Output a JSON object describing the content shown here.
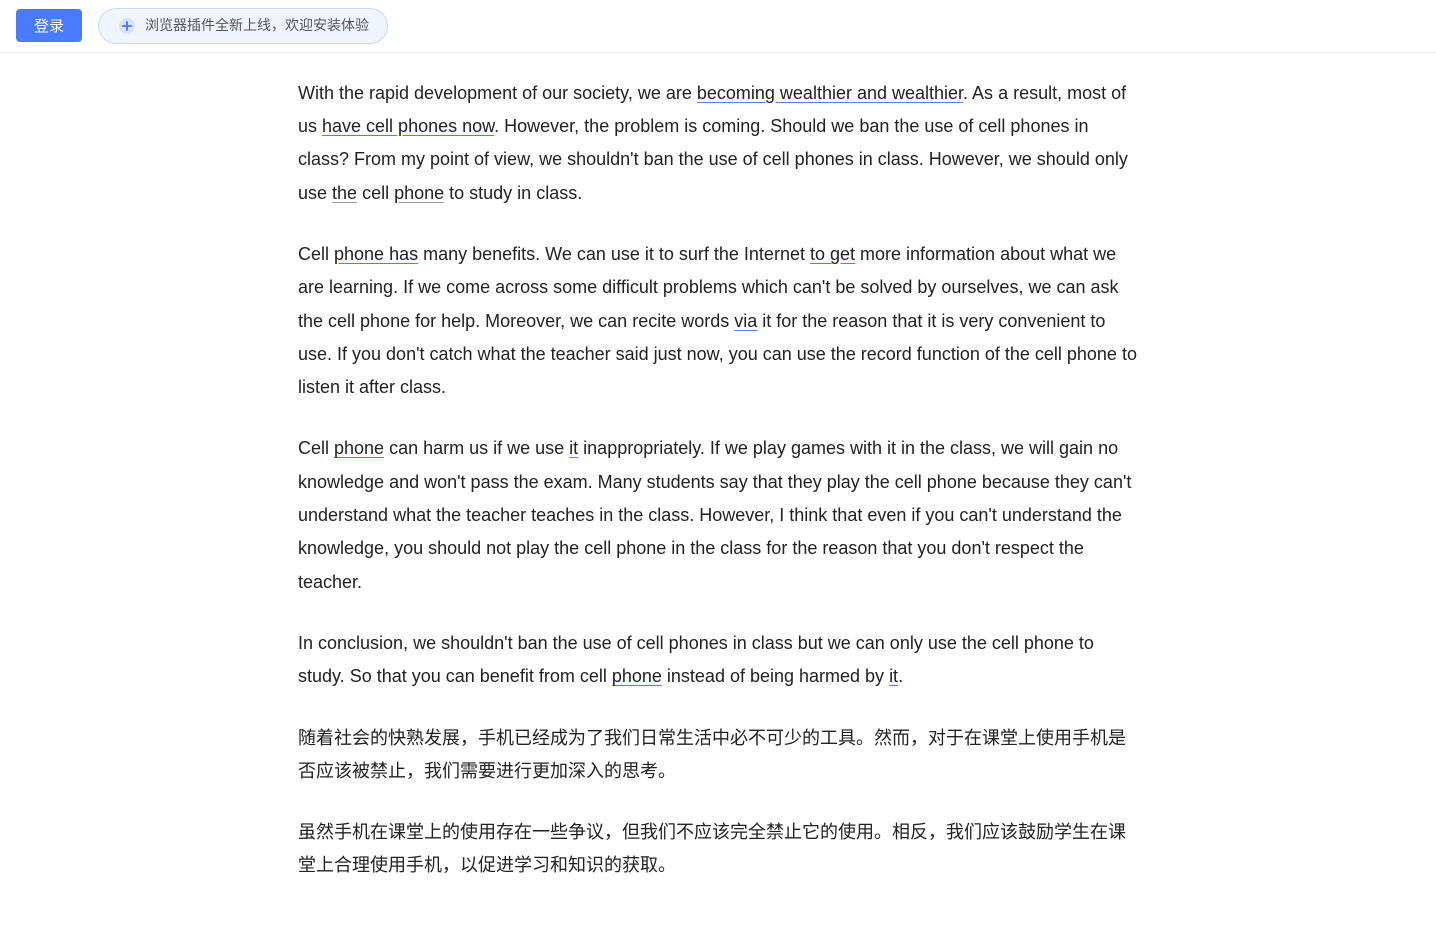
{
  "topbar": {
    "login_label": "登录",
    "plugin_text": "浏览器插件全新上线，欢迎安装体验"
  },
  "content": {
    "paragraph1": "With the rapid development of our society, we are becoming wealthier and wealthier. As a result, most of us have cell phones now. However, the problem is coming. Should we ban the use of cell phones in class? From my point of view, we shouldn't ban the use of cell phones in class. However, we should only use the cell phone to study in class.",
    "paragraph2": "Cell phone has many benefits. We can use it to surf the Internet to get more information about what we are learning. If we come across some difficult problems which can't be solved by ourselves, we can ask the cell phone for help. Moreover, we can recite words via it for the reason that it is very convenient to use. If you don't catch what the teacher said just now, you can use the record function of the cell phone to listen it after class.",
    "paragraph3": "Cell phone can harm us if we use it inappropriately. If we play games with it in the class, we will gain no knowledge and won't pass the exam. Many students say that they play the cell phone because they can't understand what the teacher teaches in the class. However, I think that even if you can't understand the knowledge, you should not play the cell phone in the class for the reason that you don't respect the teacher.",
    "paragraph4": "In conclusion, we shouldn't ban the use of cell phones in class but we can only use the cell phone to study. So that you can benefit from cell phone instead of being harmed by it.",
    "paragraph5_zh": "随着社会的快熟发展，手机已经成为了我们日常生活中必不可少的工具。然而，对于在课堂上使用手机是否应该被禁止，我们需要进行更加深入的思考。",
    "paragraph6_zh_partial": "虽然手机在课堂上的使用存在一些争议，但我们不应该完全禁止它的使用。相反，我们应该鼓励学生在课堂上合理使用手机，以促进学习和知识的获取。"
  }
}
